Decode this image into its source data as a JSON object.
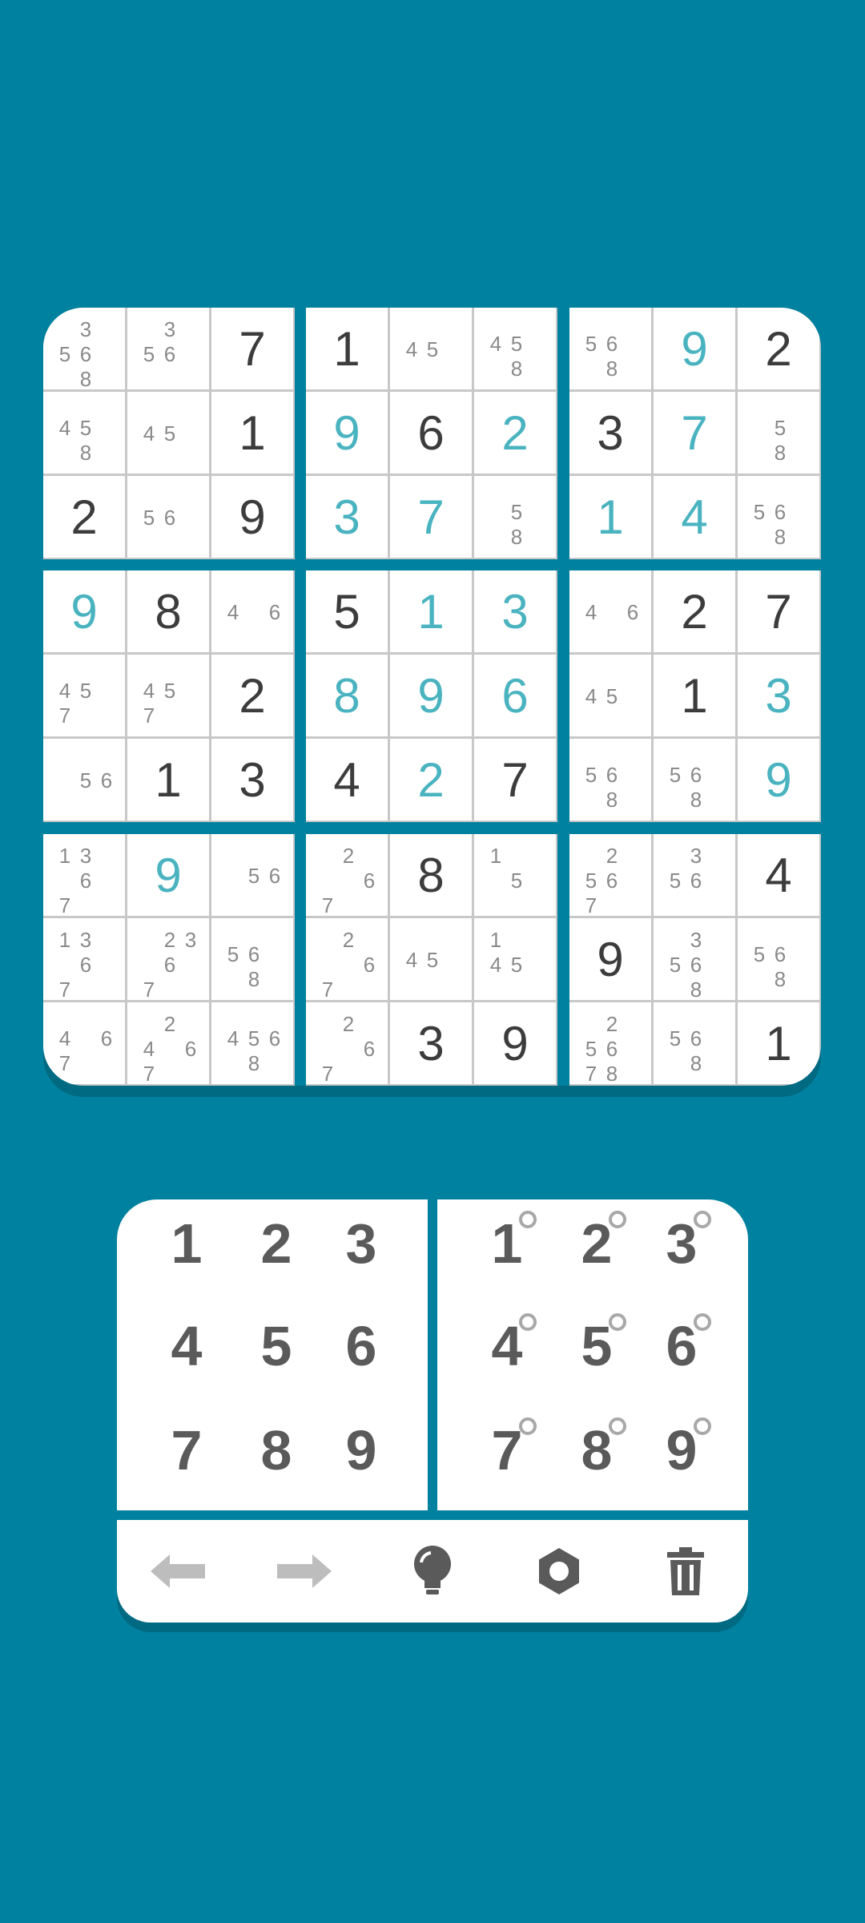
{
  "board": {
    "boxes": [
      [
        {
          "notes": [
            "",
            "3",
            "",
            "5",
            "6",
            "",
            "",
            "8",
            ""
          ]
        },
        {
          "notes": [
            "",
            "3",
            "",
            "5",
            "6",
            "",
            "",
            "",
            ""
          ]
        },
        {
          "value": "7",
          "kind": "given"
        },
        {
          "notes": [
            "",
            "",
            "",
            "4",
            "5",
            "",
            "",
            "8",
            ""
          ]
        },
        {
          "notes": [
            "",
            "",
            "",
            "4",
            "5",
            "",
            "",
            "",
            ""
          ]
        },
        {
          "value": "1",
          "kind": "given"
        },
        {
          "value": "2",
          "kind": "given"
        },
        {
          "notes": [
            "",
            "",
            "",
            "5",
            "6",
            "",
            "",
            "",
            ""
          ]
        },
        {
          "value": "9",
          "kind": "given"
        }
      ],
      [
        {
          "value": "1",
          "kind": "given"
        },
        {
          "notes": [
            "",
            "",
            "",
            "4",
            "5",
            "",
            "",
            "",
            ""
          ]
        },
        {
          "notes": [
            "",
            "",
            "",
            "4",
            "5",
            "",
            "",
            "8",
            ""
          ]
        },
        {
          "value": "9",
          "kind": "filled"
        },
        {
          "value": "6",
          "kind": "given"
        },
        {
          "value": "2",
          "kind": "filled"
        },
        {
          "value": "3",
          "kind": "filled"
        },
        {
          "value": "7",
          "kind": "filled"
        },
        {
          "notes": [
            "",
            "",
            "",
            "",
            "5",
            "",
            "",
            "8",
            ""
          ]
        }
      ],
      [
        {
          "notes": [
            "",
            "",
            "",
            "5",
            "6",
            "",
            "",
            "8",
            ""
          ]
        },
        {
          "value": "9",
          "kind": "filled"
        },
        {
          "value": "2",
          "kind": "given"
        },
        {
          "value": "3",
          "kind": "given"
        },
        {
          "value": "7",
          "kind": "filled"
        },
        {
          "notes": [
            "",
            "",
            "",
            "",
            "5",
            "",
            "",
            "8",
            ""
          ]
        },
        {
          "value": "1",
          "kind": "filled"
        },
        {
          "value": "4",
          "kind": "filled"
        },
        {
          "notes": [
            "",
            "",
            "",
            "5",
            "6",
            "",
            "",
            "8",
            ""
          ]
        }
      ],
      [
        {
          "value": "9",
          "kind": "filled"
        },
        {
          "value": "8",
          "kind": "given"
        },
        {
          "notes": [
            "",
            "",
            "",
            "4",
            "",
            "6",
            "",
            "",
            ""
          ]
        },
        {
          "notes": [
            "",
            "",
            "",
            "4",
            "5",
            "",
            "7",
            "",
            ""
          ]
        },
        {
          "notes": [
            "",
            "",
            "",
            "4",
            "5",
            "",
            "7",
            "",
            ""
          ]
        },
        {
          "value": "2",
          "kind": "given"
        },
        {
          "notes": [
            "",
            "",
            "",
            "",
            "5",
            "6",
            "",
            "",
            ""
          ]
        },
        {
          "value": "1",
          "kind": "given"
        },
        {
          "value": "3",
          "kind": "given"
        }
      ],
      [
        {
          "value": "5",
          "kind": "given"
        },
        {
          "value": "1",
          "kind": "filled"
        },
        {
          "value": "3",
          "kind": "filled"
        },
        {
          "value": "8",
          "kind": "filled"
        },
        {
          "value": "9",
          "kind": "filled"
        },
        {
          "value": "6",
          "kind": "filled"
        },
        {
          "value": "4",
          "kind": "given"
        },
        {
          "value": "2",
          "kind": "filled"
        },
        {
          "value": "7",
          "kind": "given"
        }
      ],
      [
        {
          "notes": [
            "",
            "",
            "",
            "4",
            "",
            "6",
            "",
            "",
            ""
          ]
        },
        {
          "value": "2",
          "kind": "given"
        },
        {
          "value": "7",
          "kind": "given"
        },
        {
          "notes": [
            "",
            "",
            "",
            "4",
            "5",
            "",
            "",
            "",
            ""
          ]
        },
        {
          "value": "1",
          "kind": "given"
        },
        {
          "value": "3",
          "kind": "filled"
        },
        {
          "notes": [
            "",
            "",
            "",
            "5",
            "6",
            "",
            "",
            "8",
            ""
          ]
        },
        {
          "notes": [
            "",
            "",
            "",
            "5",
            "6",
            "",
            "",
            "8",
            ""
          ]
        },
        {
          "value": "9",
          "kind": "filled"
        }
      ],
      [
        {
          "notes": [
            "1",
            "3",
            "",
            "",
            "6",
            "",
            "7",
            "",
            ""
          ]
        },
        {
          "value": "9",
          "kind": "filled"
        },
        {
          "notes": [
            "",
            "",
            "",
            "",
            "5",
            "6",
            "",
            "",
            ""
          ]
        },
        {
          "notes": [
            "1",
            "3",
            "",
            "",
            "6",
            "",
            "7",
            "",
            ""
          ]
        },
        {
          "notes": [
            "",
            "2",
            "3",
            "",
            "6",
            "",
            "7",
            "",
            ""
          ]
        },
        {
          "notes": [
            "",
            "",
            "",
            "5",
            "6",
            "",
            "",
            "8",
            ""
          ]
        },
        {
          "notes": [
            "",
            "",
            "",
            "4",
            "",
            "6",
            "7",
            "",
            ""
          ]
        },
        {
          "notes": [
            "",
            "2",
            "",
            "4",
            "",
            "6",
            "7",
            "",
            ""
          ]
        },
        {
          "notes": [
            "",
            "",
            "",
            "4",
            "5",
            "6",
            "",
            "8",
            ""
          ]
        }
      ],
      [
        {
          "notes": [
            "",
            "2",
            "",
            "",
            "",
            "6",
            "7",
            "",
            ""
          ]
        },
        {
          "value": "8",
          "kind": "given"
        },
        {
          "notes": [
            "1",
            "",
            "",
            "",
            "5",
            "",
            "",
            "",
            ""
          ]
        },
        {
          "notes": [
            "",
            "2",
            "",
            "",
            "",
            "6",
            "7",
            "",
            ""
          ]
        },
        {
          "notes": [
            "",
            "",
            "",
            "4",
            "5",
            "",
            "",
            "",
            ""
          ]
        },
        {
          "notes": [
            "1",
            "",
            "",
            "4",
            "5",
            "",
            "",
            "",
            ""
          ]
        },
        {
          "notes": [
            "",
            "2",
            "",
            "",
            "",
            "6",
            "7",
            "",
            ""
          ]
        },
        {
          "value": "3",
          "kind": "given"
        },
        {
          "value": "9",
          "kind": "given"
        }
      ],
      [
        {
          "notes": [
            "",
            "2",
            "",
            "5",
            "6",
            "",
            "7",
            "",
            ""
          ]
        },
        {
          "notes": [
            "",
            "3",
            "",
            "5",
            "6",
            "",
            "",
            "",
            ""
          ]
        },
        {
          "value": "4",
          "kind": "given"
        },
        {
          "value": "9",
          "kind": "given"
        },
        {
          "notes": [
            "",
            "3",
            "",
            "5",
            "6",
            "",
            "",
            "8",
            ""
          ]
        },
        {
          "notes": [
            "",
            "",
            "",
            "5",
            "6",
            "",
            "",
            "8",
            ""
          ]
        },
        {
          "notes": [
            "",
            "2",
            "",
            "5",
            "6",
            "",
            "7",
            "8",
            ""
          ]
        },
        {
          "notes": [
            "",
            "",
            "",
            "5",
            "6",
            "",
            "",
            "8",
            ""
          ]
        },
        {
          "value": "1",
          "kind": "given"
        }
      ]
    ]
  },
  "number_pad": {
    "keys": [
      "1",
      "2",
      "3",
      "4",
      "5",
      "6",
      "7",
      "8",
      "9"
    ]
  },
  "notes_pad": {
    "keys": [
      "1",
      "2",
      "3",
      "4",
      "5",
      "6",
      "7",
      "8",
      "9"
    ]
  },
  "toolbar": {
    "undo_icon": "arrow-left-icon",
    "redo_icon": "arrow-right-icon",
    "hint_icon": "lightbulb-icon",
    "settings_icon": "gear-icon",
    "delete_icon": "trash-icon"
  },
  "colors": {
    "background": "#00819f",
    "given_digit": "#3c3c3c",
    "filled_digit": "#4ab3c0",
    "note_digit": "#8a8a8a",
    "pad_digit": "#5a5a5a",
    "disabled_icon": "#bdbdbd"
  }
}
